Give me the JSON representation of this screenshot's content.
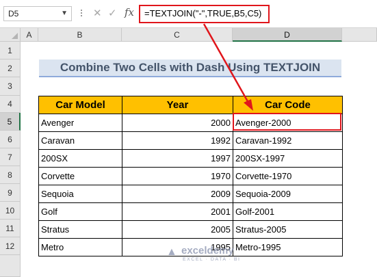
{
  "formula_bar": {
    "name_box": "D5",
    "cancel_glyph": "✕",
    "enter_glyph": "✓",
    "fx_label": "fx",
    "formula": "=TEXTJOIN(\"-\",TRUE,B5,C5)"
  },
  "columns": [
    "A",
    "B",
    "C",
    "D"
  ],
  "rows": [
    "1",
    "2",
    "3",
    "4",
    "5",
    "6",
    "7",
    "8",
    "9",
    "10",
    "11",
    "12"
  ],
  "selected_cell": "D5",
  "title": "Combine Two Cells with Dash Using TEXTJOIN",
  "table": {
    "headers": [
      "Car Model",
      "Year",
      "Car Code"
    ],
    "rows": [
      [
        "Avenger",
        "2000",
        "Avenger-2000"
      ],
      [
        "Caravan",
        "1992",
        "Caravan-1992"
      ],
      [
        "200SX",
        "1997",
        "200SX-1997"
      ],
      [
        "Corvette",
        "1970",
        "Corvette-1970"
      ],
      [
        "Sequoia",
        "2009",
        "Sequoia-2009"
      ],
      [
        "Golf",
        "2001",
        "Golf-2001"
      ],
      [
        "Stratus",
        "2005",
        "Stratus-2005"
      ],
      [
        "Metro",
        "1995",
        "Metro-1995"
      ]
    ]
  },
  "watermark": {
    "name": "exceldemy",
    "tagline": "EXCEL · DATA · BI"
  },
  "colors": {
    "header_fill": "#ffc000",
    "title_fill": "#dbe4f0",
    "title_text": "#44546a",
    "highlight": "#e0151b",
    "excel_green": "#217346"
  }
}
